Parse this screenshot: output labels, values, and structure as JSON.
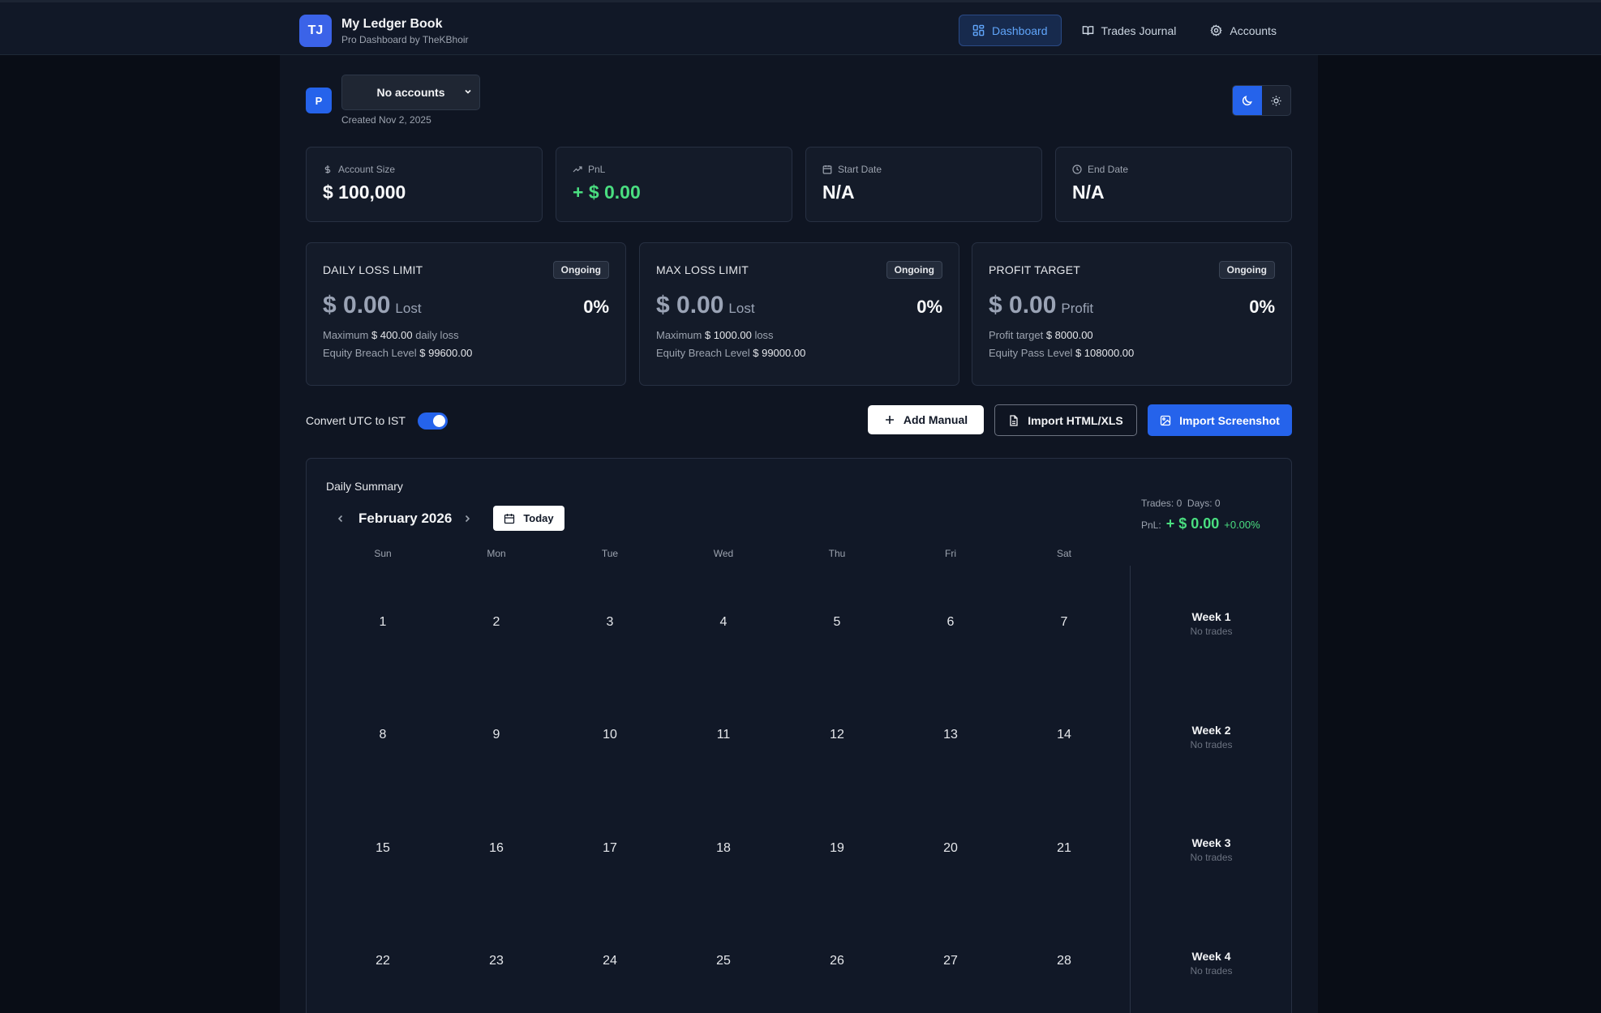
{
  "brand": {
    "logo": "TJ",
    "title": "My Ledger Book",
    "subtitle": "Pro Dashboard by TheKBhoir"
  },
  "nav": [
    {
      "label": "Dashboard",
      "icon": "dashboard-icon",
      "active": true
    },
    {
      "label": "Trades Journal",
      "icon": "book-icon",
      "active": false
    },
    {
      "label": "Accounts",
      "icon": "gear-icon",
      "active": false
    }
  ],
  "account": {
    "badge": "P",
    "selected": "No accounts",
    "created": "Created Nov 2, 2025"
  },
  "stats": [
    {
      "label": "Account Size",
      "value": "$ 100,000",
      "icon": "dollar-icon"
    },
    {
      "label": "PnL",
      "value": "+ $ 0.00",
      "icon": "trending-up-icon"
    },
    {
      "label": "Start Date",
      "value": "N/A",
      "icon": "calendar-icon"
    },
    {
      "label": "End Date",
      "value": "N/A",
      "icon": "clock-icon"
    }
  ],
  "limits": [
    {
      "title": "DAILY LOSS LIMIT",
      "status": "Ongoing",
      "amount": "$ 0.00",
      "unit": "Lost",
      "percent": "0%",
      "line1_label": "Maximum",
      "line1_value": "$ 400.00",
      "line1_suffix": "daily loss",
      "line2_label": "Equity Breach Level",
      "line2_value": "$ 99600.00"
    },
    {
      "title": "MAX LOSS LIMIT",
      "status": "Ongoing",
      "amount": "$ 0.00",
      "unit": "Lost",
      "percent": "0%",
      "line1_label": "Maximum",
      "line1_value": "$ 1000.00",
      "line1_suffix": "loss",
      "line2_label": "Equity Breach Level",
      "line2_value": "$ 99000.00"
    },
    {
      "title": "PROFIT TARGET",
      "status": "Ongoing",
      "amount": "$ 0.00",
      "unit": "Profit",
      "percent": "0%",
      "line1_label": "Profit target",
      "line1_value": "$ 8000.00",
      "line1_suffix": "",
      "line2_label": "Equity Pass Level",
      "line2_value": "$ 108000.00"
    }
  ],
  "utc_toggle": {
    "label": "Convert UTC to IST",
    "on": true
  },
  "actions": {
    "add_manual": "Add Manual",
    "import_html": "Import HTML/XLS",
    "import_screenshot": "Import Screenshot"
  },
  "calendar": {
    "title": "Daily Summary",
    "month": "February 2026",
    "today": "Today",
    "summary": {
      "trades": "Trades: 0",
      "days": "Days: 0",
      "pnl_label": "PnL:",
      "pnl_value": "+ $ 0.00",
      "pnl_pct": "+0.00%"
    },
    "weekdays": [
      "Sun",
      "Mon",
      "Tue",
      "Wed",
      "Thu",
      "Fri",
      "Sat"
    ],
    "weeks": [
      [
        "1",
        "2",
        "3",
        "4",
        "5",
        "6",
        "7"
      ],
      [
        "8",
        "9",
        "10",
        "11",
        "12",
        "13",
        "14"
      ],
      [
        "15",
        "16",
        "17",
        "18",
        "19",
        "20",
        "21"
      ],
      [
        "22",
        "23",
        "24",
        "25",
        "26",
        "27",
        "28"
      ]
    ],
    "week_summaries": [
      {
        "name": "Week 1",
        "status": "No trades"
      },
      {
        "name": "Week 2",
        "status": "No trades"
      },
      {
        "name": "Week 3",
        "status": "No trades"
      },
      {
        "name": "Week 4",
        "status": "No trades"
      }
    ]
  },
  "colors": {
    "accent": "#2563eb",
    "positive": "#4ade80",
    "background": "#090d16",
    "panel": "#141b29"
  }
}
